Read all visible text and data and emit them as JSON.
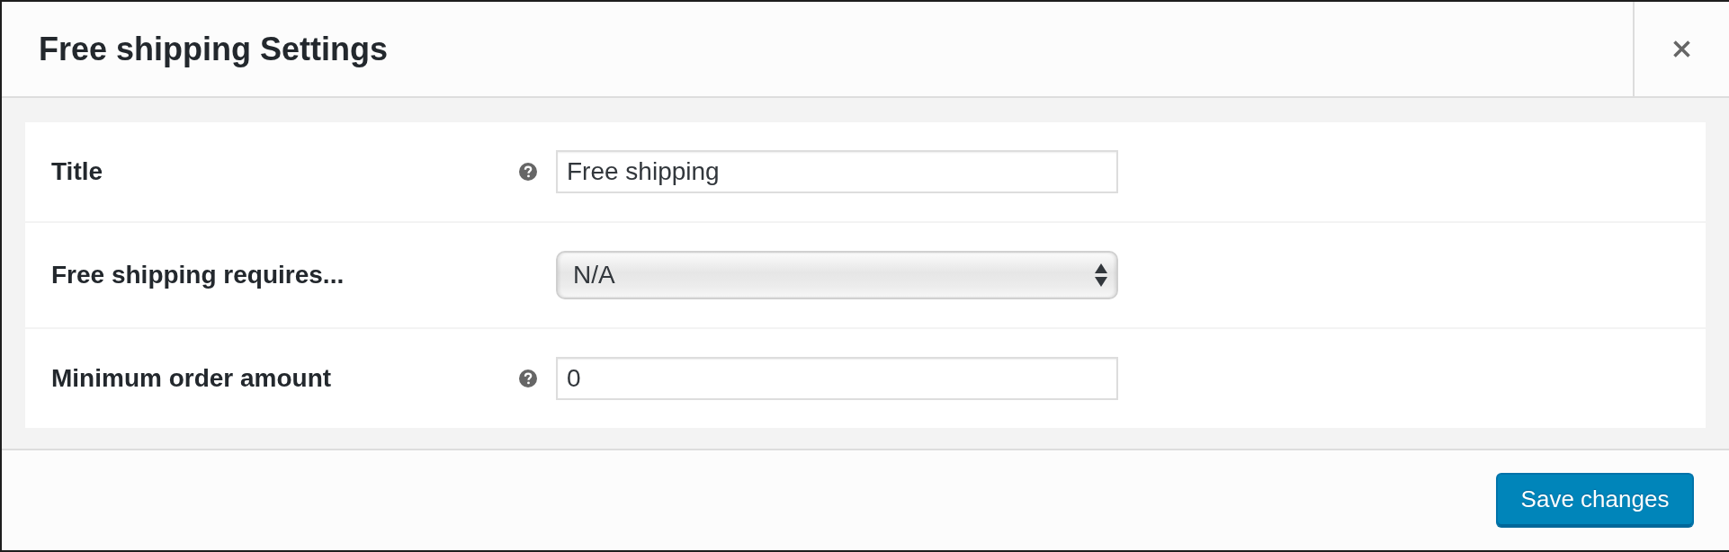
{
  "modal": {
    "title": "Free shipping Settings"
  },
  "settings": [
    {
      "kind": "text",
      "label": "Title",
      "help": true,
      "value": "Free shipping"
    },
    {
      "kind": "select",
      "label": "Free shipping requires...",
      "help": false,
      "value": "N/A"
    },
    {
      "kind": "text",
      "label": "Minimum order amount",
      "help": true,
      "value": "0"
    }
  ],
  "footer": {
    "save_button": "Save changes"
  }
}
